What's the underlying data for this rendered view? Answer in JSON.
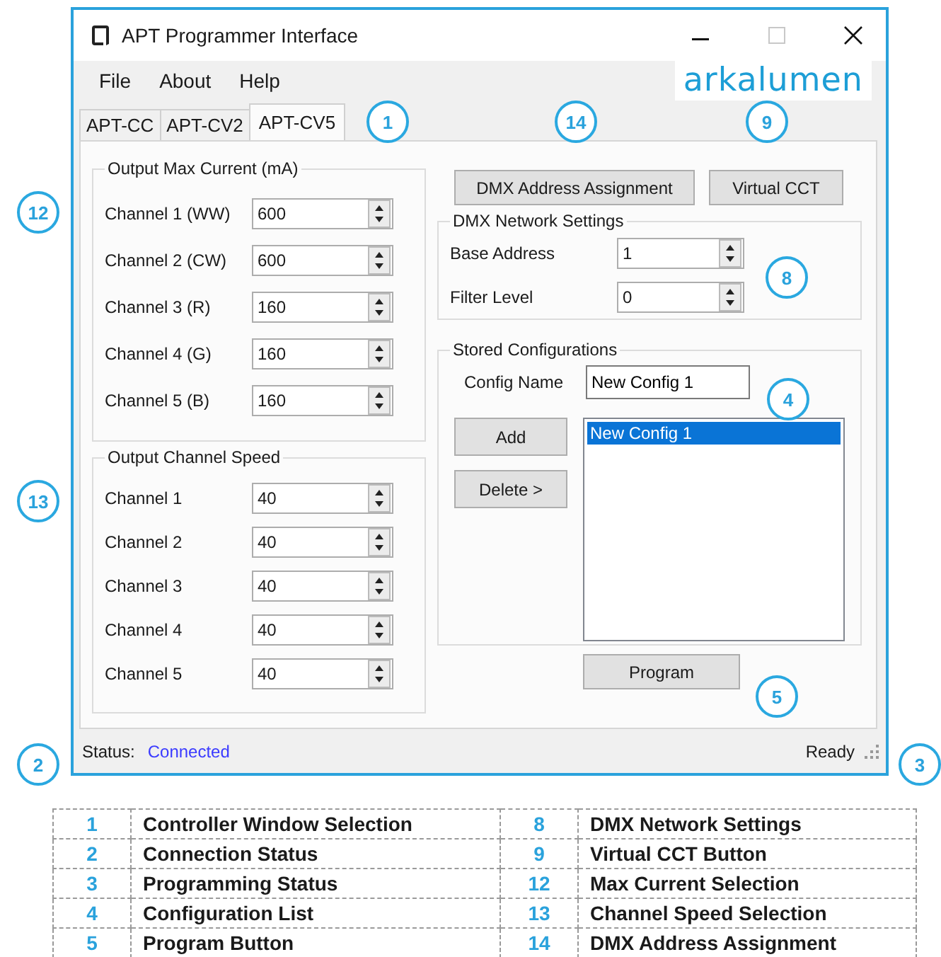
{
  "window": {
    "title": "APT Programmer Interface"
  },
  "menu": [
    "File",
    "About",
    "Help"
  ],
  "logo": {
    "text": "arkalumen"
  },
  "tabs": [
    {
      "label": "APT-CC",
      "selected": false
    },
    {
      "label": "APT-CV2",
      "selected": false
    },
    {
      "label": "APT-CV5",
      "selected": true
    }
  ],
  "max_current": {
    "title": "Output Max Current (mA)",
    "rows": [
      {
        "label": "Channel 1 (WW)",
        "value": "600"
      },
      {
        "label": "Channel 2 (CW)",
        "value": "600"
      },
      {
        "label": "Channel 3 (R)",
        "value": "160"
      },
      {
        "label": "Channel 4 (G)",
        "value": "160"
      },
      {
        "label": "Channel 5 (B)",
        "value": "160"
      }
    ]
  },
  "channel_speed": {
    "title": "Output Channel Speed",
    "rows": [
      {
        "label": "Channel 1",
        "value": "40"
      },
      {
        "label": "Channel 2",
        "value": "40"
      },
      {
        "label": "Channel 3",
        "value": "40"
      },
      {
        "label": "Channel 4",
        "value": "40"
      },
      {
        "label": "Channel 5",
        "value": "40"
      }
    ]
  },
  "top_buttons": [
    "DMX Address Assignment",
    "Virtual CCT"
  ],
  "dmx_network": {
    "title": "DMX Network Settings",
    "rows": [
      {
        "label": "Base Address",
        "value": "1"
      },
      {
        "label": "Filter Level",
        "value": "0"
      }
    ]
  },
  "stored": {
    "title": "Stored Configurations",
    "name_label": "Config Name",
    "name_value": "New Config 1",
    "buttons": [
      "Add",
      "Delete >"
    ],
    "list": [
      {
        "label": "New Config 1",
        "selected": true
      }
    ]
  },
  "program_button": "Program",
  "status_bar": {
    "label": "Status:",
    "value": "Connected",
    "right": "Ready"
  },
  "callouts": [
    "1",
    "14",
    "9",
    "12",
    "13",
    "8",
    "4",
    "5",
    "2",
    "3"
  ],
  "legend": [
    [
      {
        "number": "1",
        "text": "Controller Window Selection"
      },
      {
        "number": "8",
        "text": "DMX Network Settings"
      }
    ],
    [
      {
        "number": "2",
        "text": "Connection Status"
      },
      {
        "number": "9",
        "text": "Virtual CCT Button"
      }
    ],
    [
      {
        "number": "3",
        "text": "Programming Status"
      },
      {
        "number": "12",
        "text": "Max Current Selection"
      }
    ],
    [
      {
        "number": "4",
        "text": "Configuration List"
      },
      {
        "number": "13",
        "text": "Channel Speed Selection"
      }
    ],
    [
      {
        "number": "5",
        "text": "Program Button"
      },
      {
        "number": "14",
        "text": "DMX Address Assignment"
      }
    ]
  ]
}
